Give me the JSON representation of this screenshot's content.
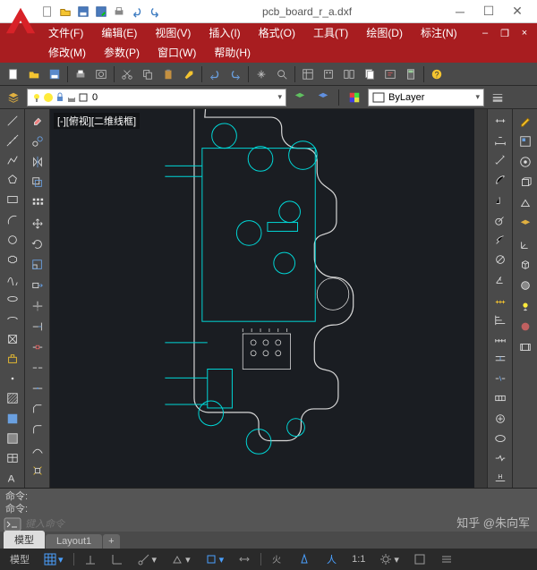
{
  "title": "pcb_board_r_a.dxf",
  "menus": {
    "row1": [
      {
        "label": "文件(F)"
      },
      {
        "label": "编辑(E)"
      },
      {
        "label": "视图(V)"
      },
      {
        "label": "插入(I)"
      },
      {
        "label": "格式(O)"
      },
      {
        "label": "工具(T)"
      },
      {
        "label": "绘图(D)"
      },
      {
        "label": "标注(N)"
      }
    ],
    "row2": [
      {
        "label": "修改(M)"
      },
      {
        "label": "参数(P)"
      },
      {
        "label": "窗口(W)"
      },
      {
        "label": "帮助(H)"
      }
    ]
  },
  "layer": {
    "current": "0",
    "style": "ByLayer"
  },
  "canvas": {
    "label": "[-][俯视][二维线框]"
  },
  "cmd": {
    "hist1": "命令:",
    "hist2": "命令:",
    "placeholder": "键入命令"
  },
  "tabs": {
    "model": "模型",
    "layout": "Layout1"
  },
  "status": {
    "model": "模型",
    "ratio": "1:1"
  },
  "watermark": "知乎 @朱向军"
}
